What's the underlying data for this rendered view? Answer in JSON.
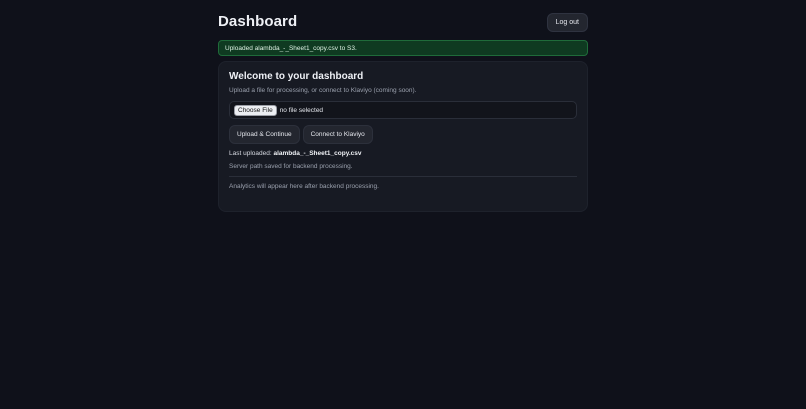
{
  "header": {
    "title": "Dashboard",
    "logout_label": "Log out"
  },
  "alert": {
    "message": "Uploaded alambda_-_Sheet1_copy.csv to S3."
  },
  "card": {
    "title": "Welcome to your dashboard",
    "subtitle": "Upload a file for processing, or connect to Klaviyo (coming soon).",
    "file_input": {
      "button_label": "Choose File",
      "status": "no file selected"
    },
    "upload_button": "Upload & Continue",
    "klaviyo_button": "Connect to Klaviyo",
    "last_uploaded_label": "Last uploaded:",
    "last_uploaded_file": "alambda_-_Sheet1_copy.csv",
    "saved_note": "Server path saved for backend processing.",
    "analytics_note": "Analytics will appear here after backend processing."
  }
}
